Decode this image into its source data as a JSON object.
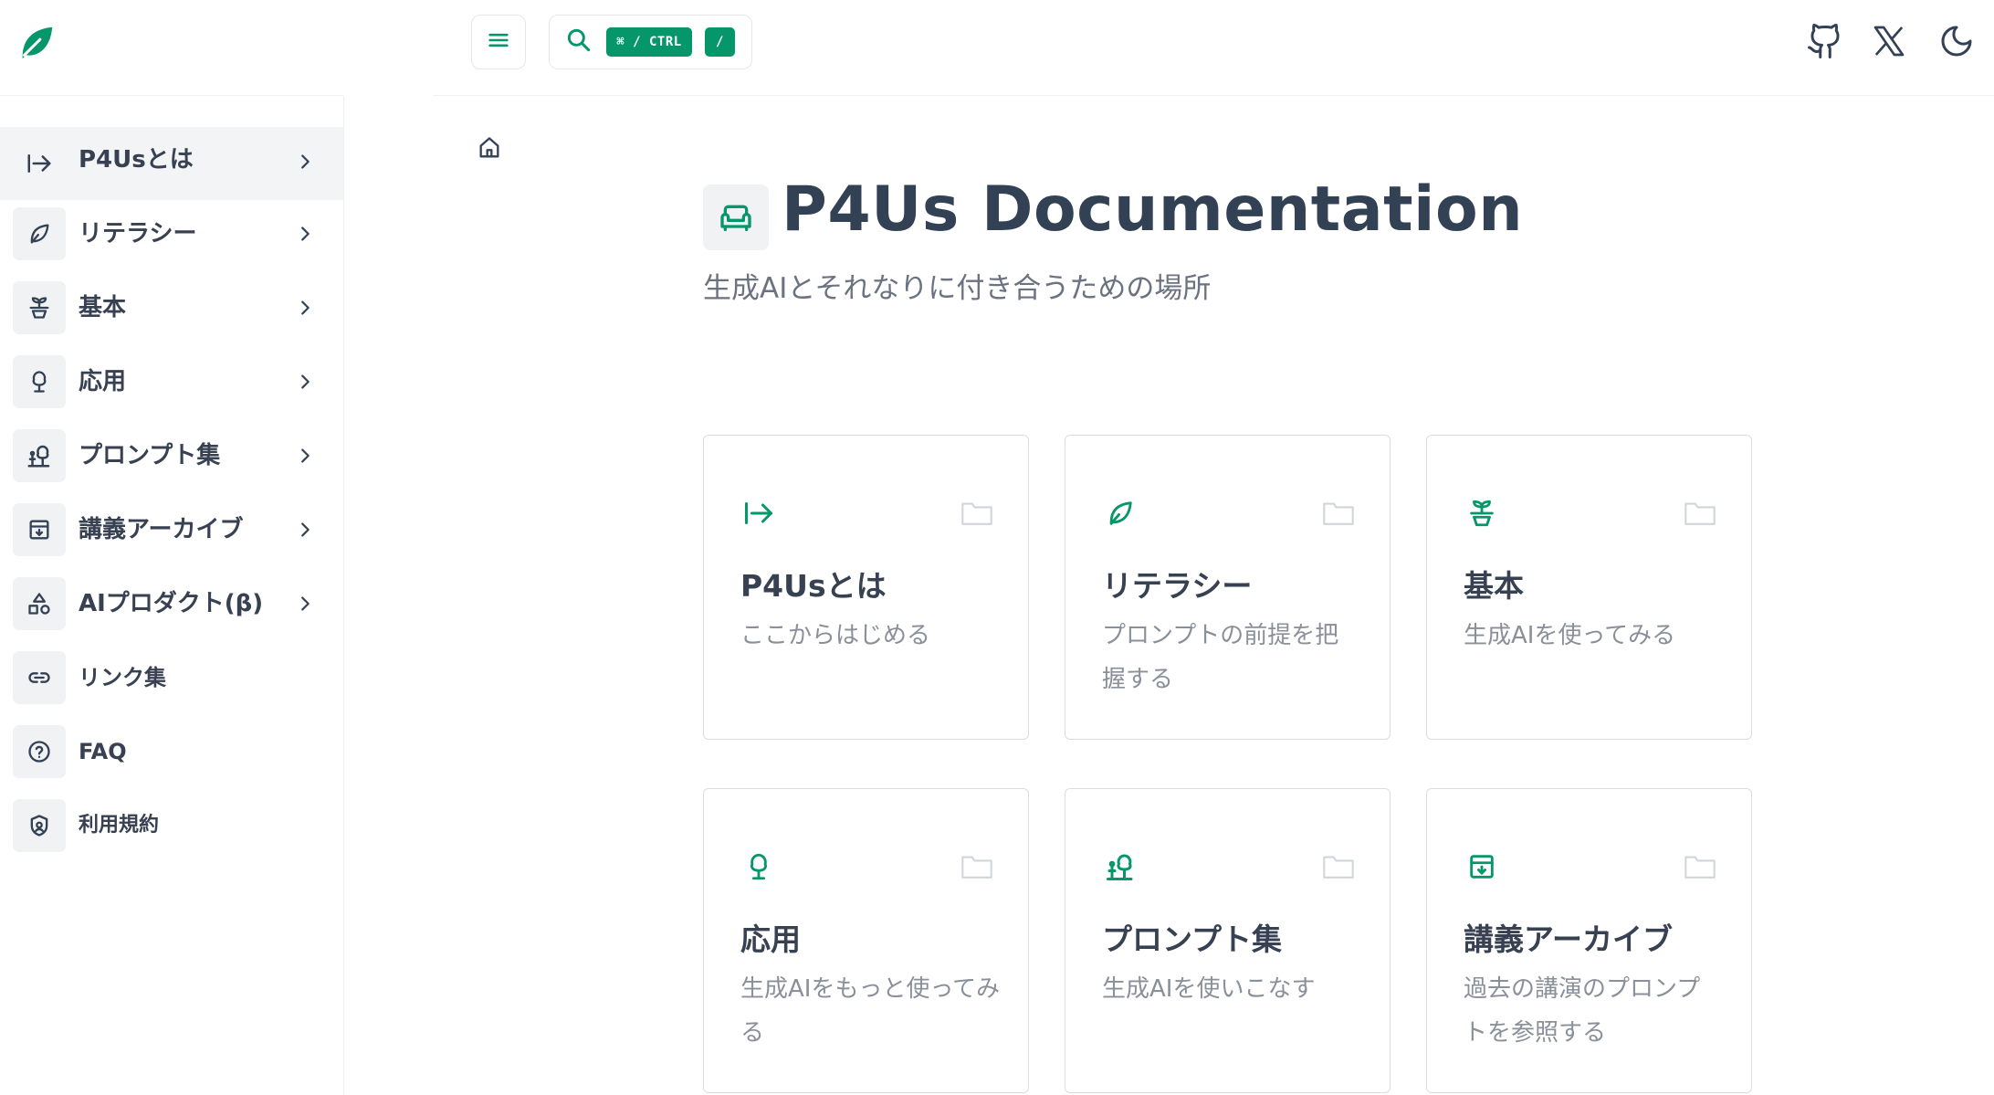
{
  "header": {
    "logo_icon": "leaf-icon",
    "menu_icon": "hamburger-menu-icon",
    "search_icon": "search-icon",
    "search_shortcut_primary": "⌘ / CTRL",
    "search_shortcut_secondary": "/",
    "github_icon": "github-icon",
    "x_icon": "x-twitter-icon",
    "theme_icon": "moon-icon",
    "accent_color": "#059669"
  },
  "sidebar": {
    "items": [
      {
        "label": "P4Usとは",
        "icon": "arrow-right-to-line-icon",
        "has_children": true,
        "active": true
      },
      {
        "label": "リテラシー",
        "icon": "leaf-outline-icon",
        "has_children": true
      },
      {
        "label": "基本",
        "icon": "sprout-icon",
        "has_children": true
      },
      {
        "label": "応用",
        "icon": "tree-icon",
        "has_children": true
      },
      {
        "label": "プロンプト集",
        "icon": "trees-icon",
        "has_children": true
      },
      {
        "label": "講義アーカイブ",
        "icon": "archive-icon",
        "has_children": true
      },
      {
        "label": "AIプロダクト(β)",
        "icon": "shapes-icon",
        "has_children": true
      },
      {
        "label": "リンク集",
        "icon": "link-icon",
        "has_children": false
      },
      {
        "label": "FAQ",
        "icon": "help-circle-icon",
        "has_children": false
      },
      {
        "label": "利用規約",
        "icon": "shield-icon",
        "has_children": false
      }
    ]
  },
  "main": {
    "breadcrumb_icon": "home-icon",
    "title_icon": "sofa-icon",
    "title": "P4Us Documentation",
    "subtitle": "生成AIとそれなりに付き合うための場所",
    "cards": [
      {
        "title": "P4Usとは",
        "description": "ここからはじめる",
        "icon": "arrow-right-to-line-icon"
      },
      {
        "title": "リテラシー",
        "description": "プロンプトの前提を把握する",
        "icon": "leaf-outline-icon"
      },
      {
        "title": "基本",
        "description": "生成AIを使ってみる",
        "icon": "sprout-icon"
      },
      {
        "title": "応用",
        "description": "生成AIをもっと使ってみる",
        "icon": "tree-icon"
      },
      {
        "title": "プロンプト集",
        "description": "生成AIを使いこなす",
        "icon": "trees-icon"
      },
      {
        "title": "講義アーカイブ",
        "description": "過去の講演のプロンプトを参照する",
        "icon": "archive-icon"
      }
    ]
  }
}
